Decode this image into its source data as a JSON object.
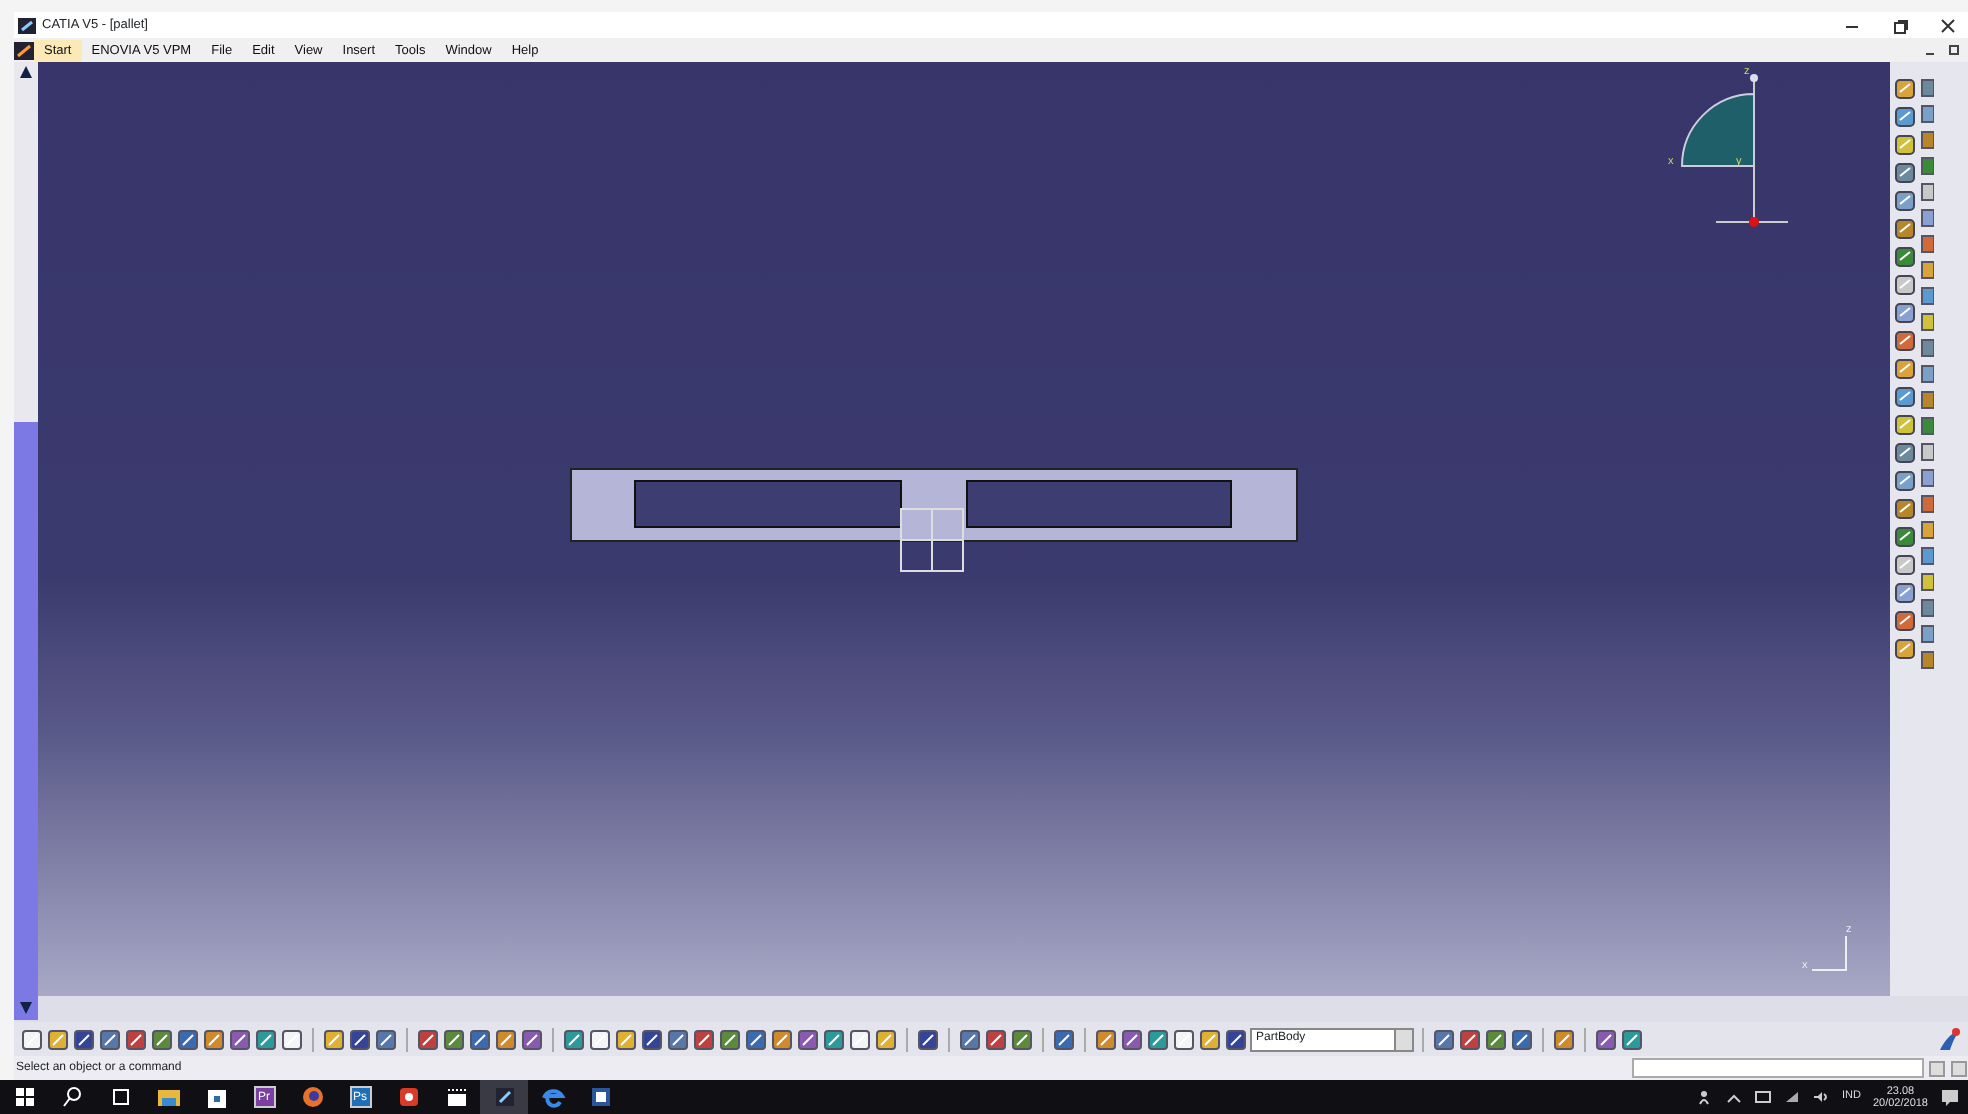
{
  "window": {
    "title": "CATIA V5 - [pallet]"
  },
  "menu": [
    {
      "label": "Start",
      "selected": true
    },
    {
      "label": "ENOVIA V5 VPM",
      "selected": false
    },
    {
      "label": "File",
      "selected": false
    },
    {
      "label": "Edit",
      "selected": false
    },
    {
      "label": "View",
      "selected": false
    },
    {
      "label": "Insert",
      "selected": false
    },
    {
      "label": "Tools",
      "selected": false
    },
    {
      "label": "Window",
      "selected": false
    },
    {
      "label": "Help",
      "selected": false
    }
  ],
  "compass": {
    "z": "z",
    "x": "x",
    "y": "y"
  },
  "axis": {
    "z": "z",
    "x": "x"
  },
  "toolbar": {
    "body_dropdown": "PartBody"
  },
  "status_bar": {
    "message": "Select an object or a command"
  },
  "taskbar": {
    "apps": [
      {
        "kind": "start",
        "selected": false
      },
      {
        "kind": "search",
        "selected": false
      },
      {
        "kind": "taskview",
        "selected": false
      },
      {
        "kind": "folder",
        "selected": false
      },
      {
        "kind": "store",
        "selected": false
      },
      {
        "kind": "tile",
        "label": "Pr",
        "color": "#7a3fa0",
        "selected": false
      },
      {
        "kind": "firefox",
        "selected": false
      },
      {
        "kind": "tile",
        "label": "Ps",
        "color": "#1f6fb8",
        "selected": false
      },
      {
        "kind": "red",
        "selected": false
      },
      {
        "kind": "clapper",
        "selected": false
      },
      {
        "kind": "catia",
        "selected": true
      },
      {
        "kind": "edge",
        "selected": false
      },
      {
        "kind": "word",
        "selected": false
      }
    ],
    "tray": {
      "language": "IND",
      "time": "23.08",
      "date": "20/02/2018"
    }
  }
}
